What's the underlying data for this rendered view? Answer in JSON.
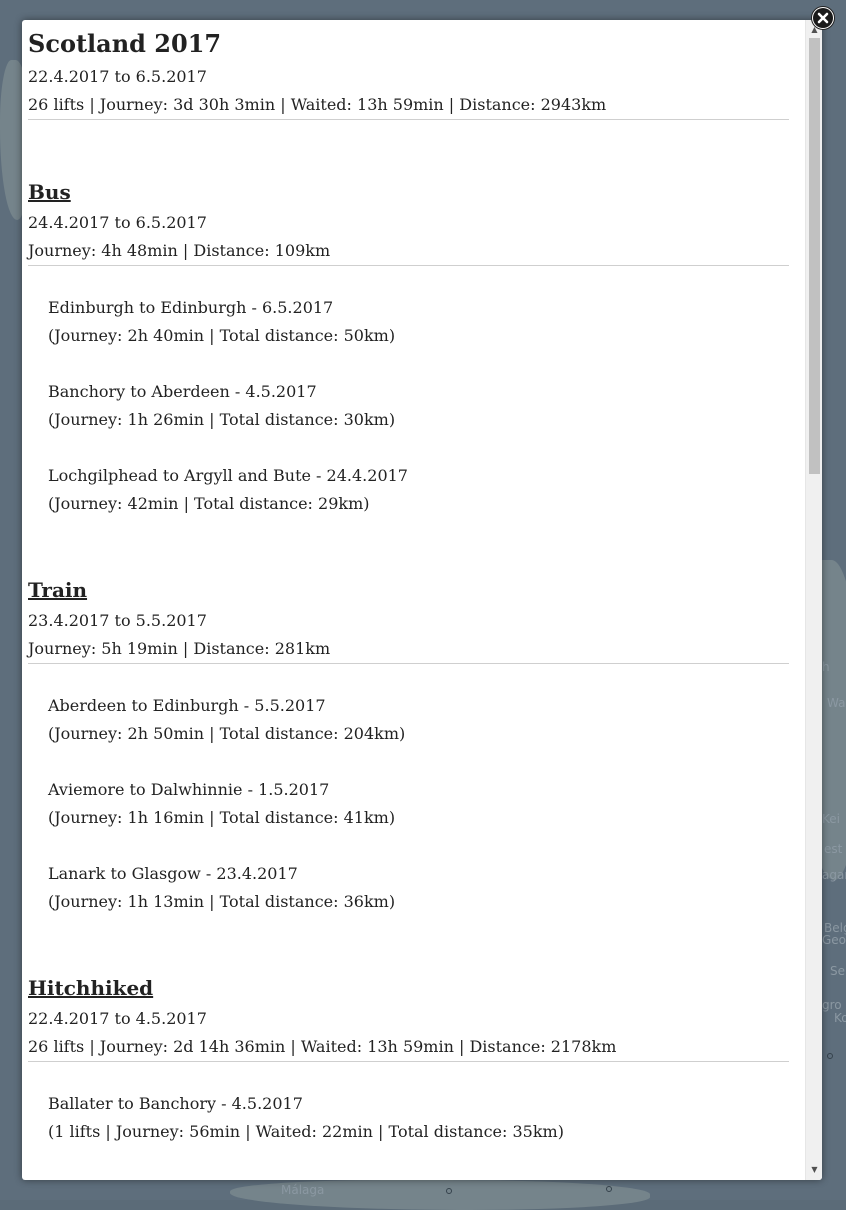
{
  "trip": {
    "title": "Scotland 2017",
    "dates": "22.4.2017 to 6.5.2017",
    "summary": "26 lifts | Journey: 3d 30h 3min | Waited: 13h 59min | Distance: 2943km"
  },
  "sections": {
    "bus": {
      "title": "Bus",
      "dates": "24.4.2017 to 6.5.2017",
      "summary": "Journey: 4h 48min | Distance: 109km",
      "entries": [
        {
          "route": "Edinburgh to Edinburgh - 6.5.2017",
          "details": "(Journey: 2h 40min | Total distance: 50km)"
        },
        {
          "route": "Banchory to Aberdeen - 4.5.2017",
          "details": "(Journey: 1h 26min | Total distance: 30km)"
        },
        {
          "route": "Lochgilphead to Argyll and Bute - 24.4.2017",
          "details": "(Journey: 42min | Total distance: 29km)"
        }
      ]
    },
    "train": {
      "title": "Train",
      "dates": "23.4.2017 to 5.5.2017",
      "summary": "Journey: 5h 19min | Distance: 281km",
      "entries": [
        {
          "route": "Aberdeen to Edinburgh - 5.5.2017",
          "details": "(Journey: 2h 50min | Total distance: 204km)"
        },
        {
          "route": "Aviemore to Dalwhinnie - 1.5.2017",
          "details": "(Journey: 1h 16min | Total distance: 41km)"
        },
        {
          "route": "Lanark to Glasgow - 23.4.2017",
          "details": "(Journey: 1h 13min | Total distance: 36km)"
        }
      ]
    },
    "hitchhiked": {
      "title": "Hitchhiked",
      "dates": "22.4.2017 to 4.5.2017",
      "summary": "26 lifts | Journey: 2d 14h 36min | Waited: 13h 59min | Distance: 2178km",
      "entries": [
        {
          "route": "Ballater to Banchory - 4.5.2017",
          "details": "(1 lifts | Journey: 56min | Waited: 22min | Total distance: 35km)"
        }
      ]
    }
  },
  "map": {
    "labels": [
      "Málaga",
      "Wa",
      "est",
      "Belg",
      "Georg",
      "Se",
      "gro",
      "Ko",
      "Kei",
      "agar",
      "h"
    ]
  },
  "icons": {
    "close": "close-icon",
    "scroll_up": "chevron-up-icon",
    "scroll_down": "chevron-down-icon"
  }
}
